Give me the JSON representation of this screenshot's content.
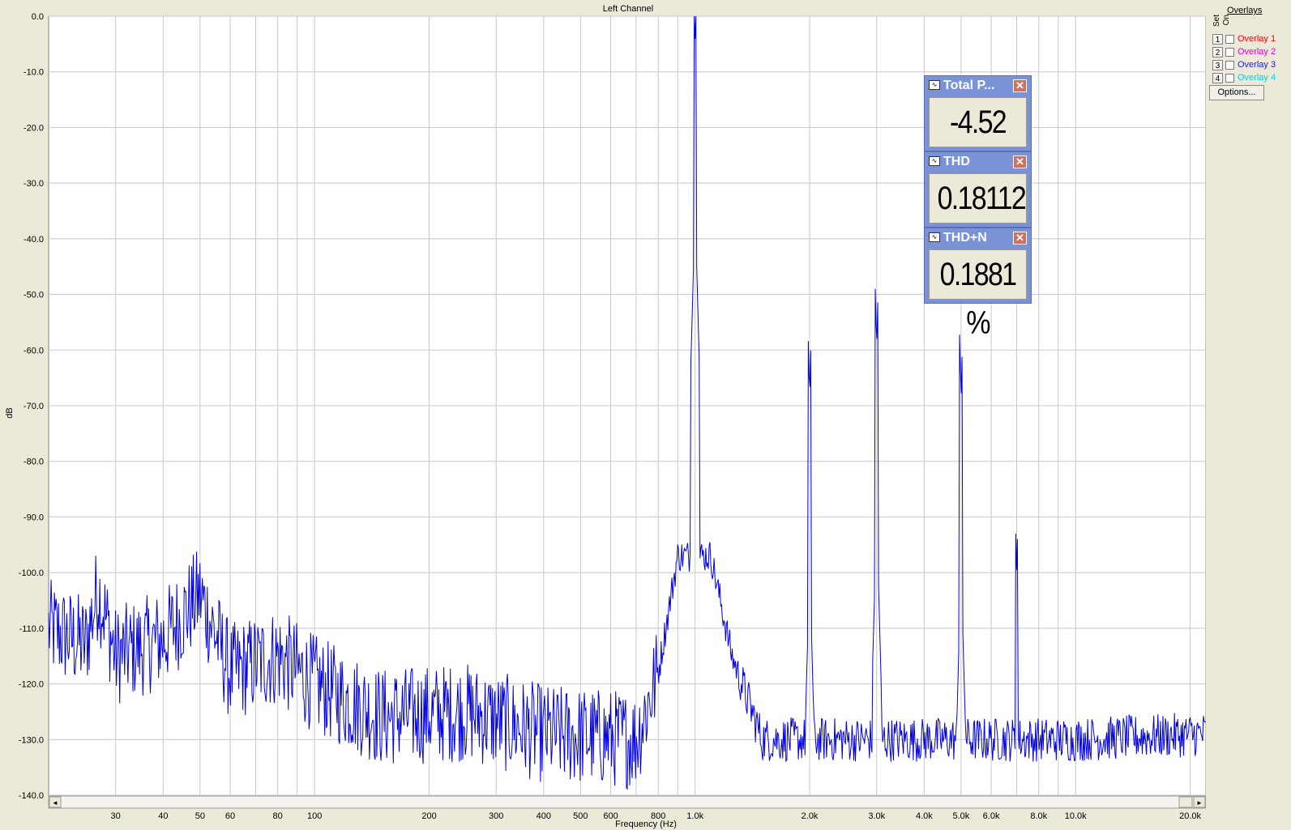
{
  "window": {
    "chart_title": "Left Channel",
    "x_axis_label": "Frequency (Hz)",
    "y_axis_label": "dB"
  },
  "overlays": {
    "title": "Overlays",
    "set_header": "Set",
    "on_header": "On",
    "items": [
      {
        "set": "1",
        "label": "Overlay 1",
        "color": "#ff0000",
        "checked": false
      },
      {
        "set": "2",
        "label": "Overlay 2",
        "color": "#e000e0",
        "checked": false
      },
      {
        "set": "3",
        "label": "Overlay 3",
        "color": "#2020e0",
        "checked": false
      },
      {
        "set": "4",
        "label": "Overlay 4",
        "color": "#00d0e0",
        "checked": false
      }
    ],
    "options_label": "Options..."
  },
  "meters": [
    {
      "name": "Total P...",
      "value": "-4.52 dB"
    },
    {
      "name": "THD",
      "value": "0.18112 %"
    },
    {
      "name": "THD+N",
      "value": "0.1881 %"
    }
  ],
  "scrollbar": {
    "left_arrow": "◄",
    "right_arrow": "►"
  },
  "chart_data": {
    "type": "line",
    "title": "Left Channel",
    "xlabel": "Frequency (Hz)",
    "ylabel": "dB",
    "x_scale": "log",
    "xlim": [
      20,
      22000
    ],
    "ylim": [
      -140,
      0
    ],
    "grid": true,
    "x_ticks": [
      {
        "value": 30,
        "label": "30"
      },
      {
        "value": 40,
        "label": "40"
      },
      {
        "value": 50,
        "label": "50"
      },
      {
        "value": 60,
        "label": "60"
      },
      {
        "value": 80,
        "label": "80"
      },
      {
        "value": 100,
        "label": "100"
      },
      {
        "value": 200,
        "label": "200"
      },
      {
        "value": 300,
        "label": "300"
      },
      {
        "value": 400,
        "label": "400"
      },
      {
        "value": 500,
        "label": "500"
      },
      {
        "value": 600,
        "label": "600"
      },
      {
        "value": 800,
        "label": "800"
      },
      {
        "value": 1000,
        "label": "1.0k"
      },
      {
        "value": 2000,
        "label": "2.0k"
      },
      {
        "value": 3000,
        "label": "3.0k"
      },
      {
        "value": 4000,
        "label": "4.0k"
      },
      {
        "value": 5000,
        "label": "5.0k"
      },
      {
        "value": 6000,
        "label": "6.0k"
      },
      {
        "value": 8000,
        "label": "8.0k"
      },
      {
        "value": 10000,
        "label": "10.0k"
      },
      {
        "value": 20000,
        "label": "20.0k"
      }
    ],
    "y_ticks": [
      {
        "value": 0,
        "label": "0.0"
      },
      {
        "value": -10,
        "label": "-10.0"
      },
      {
        "value": -20,
        "label": "-20.0"
      },
      {
        "value": -30,
        "label": "-30.0"
      },
      {
        "value": -40,
        "label": "-40.0"
      },
      {
        "value": -50,
        "label": "-50.0"
      },
      {
        "value": -60,
        "label": "-60.0"
      },
      {
        "value": -70,
        "label": "-70.0"
      },
      {
        "value": -80,
        "label": "-80.0"
      },
      {
        "value": -90,
        "label": "-90.0"
      },
      {
        "value": -100,
        "label": "-100.0"
      },
      {
        "value": -110,
        "label": "-110.0"
      },
      {
        "value": -120,
        "label": "-120.0"
      },
      {
        "value": -130,
        "label": "-130.0"
      },
      {
        "value": -140,
        "label": "-140.0"
      }
    ],
    "series": [
      {
        "color": "#0000e0",
        "peaks": [
          {
            "freq": 1000,
            "db": -4.5
          },
          {
            "freq": 2000,
            "db": -69
          },
          {
            "freq": 3000,
            "db": -60
          },
          {
            "freq": 5000,
            "db": -69
          },
          {
            "freq": 7000,
            "db": -100
          }
        ],
        "noise_floor": [
          {
            "freq": 20,
            "db": -110
          },
          {
            "freq": 25,
            "db": -113
          },
          {
            "freq": 27,
            "db": -103
          },
          {
            "freq": 30,
            "db": -115
          },
          {
            "freq": 40,
            "db": -112
          },
          {
            "freq": 50,
            "db": -104
          },
          {
            "freq": 60,
            "db": -118
          },
          {
            "freq": 80,
            "db": -115
          },
          {
            "freq": 100,
            "db": -120
          },
          {
            "freq": 150,
            "db": -126
          },
          {
            "freq": 250,
            "db": -125
          },
          {
            "freq": 400,
            "db": -129
          },
          {
            "freq": 700,
            "db": -130
          },
          {
            "freq": 800,
            "db": -118
          },
          {
            "freq": 900,
            "db": -97
          },
          {
            "freq": 1100,
            "db": -97
          },
          {
            "freq": 1250,
            "db": -115
          },
          {
            "freq": 1500,
            "db": -130
          },
          {
            "freq": 4000,
            "db": -130
          },
          {
            "freq": 10000,
            "db": -130
          },
          {
            "freq": 22000,
            "db": -129
          }
        ]
      }
    ]
  }
}
